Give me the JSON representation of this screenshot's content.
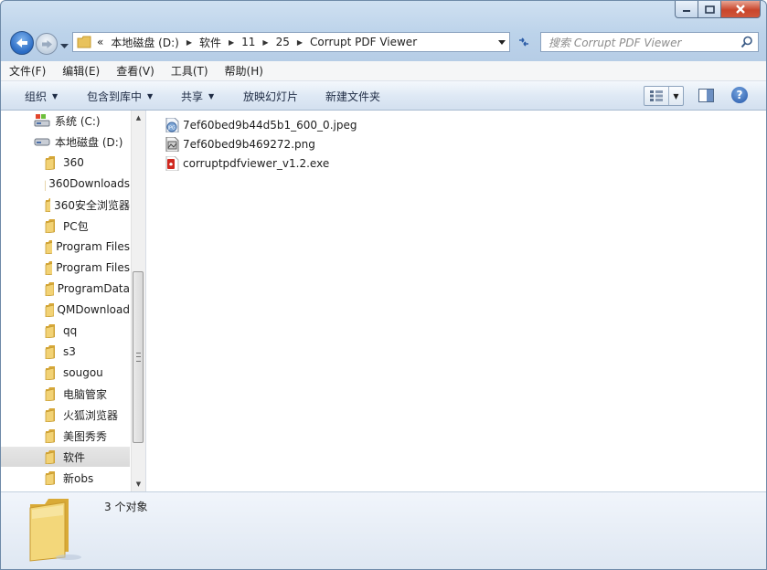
{
  "address": {
    "overflow": "«",
    "crumbs": [
      "本地磁盘 (D:)",
      "软件",
      "11",
      "25",
      "Corrupt PDF Viewer"
    ]
  },
  "search": {
    "placeholder": "搜索 Corrupt PDF Viewer"
  },
  "menu": [
    "文件(F)",
    "编辑(E)",
    "查看(V)",
    "工具(T)",
    "帮助(H)"
  ],
  "toolbar": {
    "organize": "组织",
    "include_in_library": "包含到库中",
    "share": "共享",
    "slideshow": "放映幻灯片",
    "new_folder": "新建文件夹"
  },
  "tree": [
    {
      "label": "系统 (C:)",
      "type": "drive-c"
    },
    {
      "label": "本地磁盘 (D:)",
      "type": "drive"
    },
    {
      "label": "360",
      "type": "folder"
    },
    {
      "label": "360Downloads",
      "type": "folder"
    },
    {
      "label": "360安全浏览器",
      "type": "folder"
    },
    {
      "label": "PC包",
      "type": "folder"
    },
    {
      "label": "Program Files",
      "type": "folder"
    },
    {
      "label": "Program Files",
      "type": "folder"
    },
    {
      "label": "ProgramData",
      "type": "folder"
    },
    {
      "label": "QMDownload",
      "type": "folder"
    },
    {
      "label": "qq",
      "type": "folder"
    },
    {
      "label": "s3",
      "type": "folder"
    },
    {
      "label": "sougou",
      "type": "folder"
    },
    {
      "label": "电脑管家",
      "type": "folder"
    },
    {
      "label": "火狐浏览器",
      "type": "folder"
    },
    {
      "label": "美图秀秀",
      "type": "folder"
    },
    {
      "label": "软件",
      "type": "folder",
      "selected": true
    },
    {
      "label": "新obs",
      "type": "folder"
    }
  ],
  "files": [
    {
      "name": "7ef60bed9b44d5b1_600_0.jpeg",
      "icon": "jpeg-file-icon"
    },
    {
      "name": "7ef60bed9b469272.png",
      "icon": "png-file-icon"
    },
    {
      "name": "corruptpdfviewer_v1.2.exe",
      "icon": "exe-file-icon"
    }
  ],
  "status": {
    "count": "3 个对象"
  }
}
